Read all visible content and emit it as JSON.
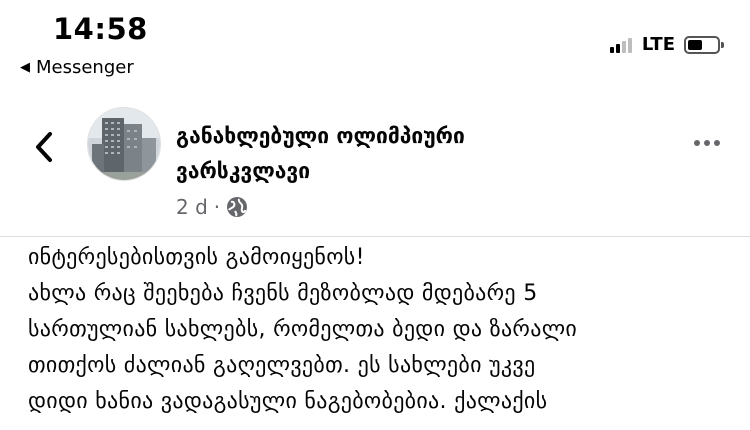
{
  "status_bar": {
    "time": "14:58",
    "back_app": "Messenger",
    "back_app_icon": "triangle-left-icon",
    "network": "LTE",
    "signal_bars_active": 2,
    "signal_bars_total": 4,
    "battery_level": 0.5
  },
  "post": {
    "page_name_line1": "განახლებული ოლიმპიური",
    "page_name_line2": "ვარსკვლავი",
    "time_ago": "2 d",
    "separator": "·",
    "privacy_icon": "globe-icon",
    "more_icon": "more-dots-icon",
    "back_icon": "chevron-left-icon",
    "body_lines": [
      "ინტერესებისთვის გამოიყენოს!",
      "ახლა რაც შეეხება ჩვენს მეზობლად მდებარე 5",
      "სართულიან სახლებს, რომელთა ბედი და ზარალი",
      "თითქოს ძალიან გაღელვებთ. ეს სახლები უკვე",
      "დიდი ხანია ვადაგასული ნაგებობებია. ქალაქის"
    ]
  },
  "colors": {
    "text_primary": "#050505",
    "text_secondary": "#65676b",
    "divider": "#dadde1"
  }
}
